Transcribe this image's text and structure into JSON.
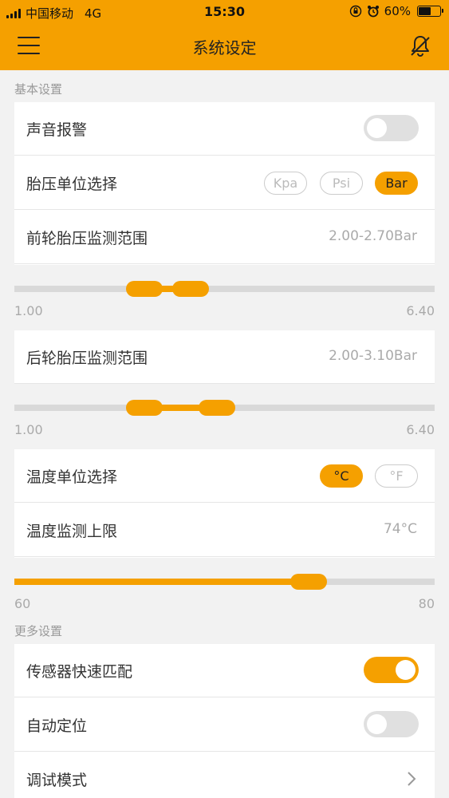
{
  "status_bar": {
    "carrier": "中国移动",
    "network": "4G",
    "time": "15:30",
    "battery": "60%",
    "battery_level": 0.6,
    "icons": [
      "orientation-lock-icon",
      "alarm-icon"
    ]
  },
  "nav": {
    "title": "系统设定",
    "menu_icon": "hamburger-icon",
    "alarm_icon": "bell-off-icon"
  },
  "colors": {
    "accent": "#f5a000",
    "background": "#f2f2f2",
    "label": "#999999"
  },
  "sections": {
    "basic": "基本设置",
    "more": "更多设置"
  },
  "settings": {
    "sound_alarm": {
      "label": "声音报警",
      "enabled": false
    },
    "pressure_unit": {
      "label": "胎压单位选择",
      "options": [
        "Kpa",
        "Psi",
        "Bar"
      ],
      "selected": "Bar"
    },
    "front_range": {
      "label": "前轮胎压监测范围",
      "value": "2.00-2.70Bar",
      "min_label": "1.00",
      "max_label": "6.40",
      "min": 1.0,
      "max": 6.4,
      "low": 2.0,
      "high": 2.7
    },
    "rear_range": {
      "label": "后轮胎压监测范围",
      "value": "2.00-3.10Bar",
      "min_label": "1.00",
      "max_label": "6.40",
      "min": 1.0,
      "max": 6.4,
      "low": 2.0,
      "high": 3.1
    },
    "temp_unit": {
      "label": "温度单位选择",
      "options": [
        "°C",
        "°F"
      ],
      "selected": "°C"
    },
    "temp_limit": {
      "label": "温度监测上限",
      "value": "74°C",
      "min_label": "60",
      "max_label": "80",
      "min": 60,
      "max": 80,
      "current": 74
    },
    "quick_pair": {
      "label": "传感器快速匹配",
      "enabled": true
    },
    "auto_locate": {
      "label": "自动定位",
      "enabled": false
    },
    "debug_mode": {
      "label": "调试模式",
      "icon": "chevron-right-icon"
    }
  }
}
